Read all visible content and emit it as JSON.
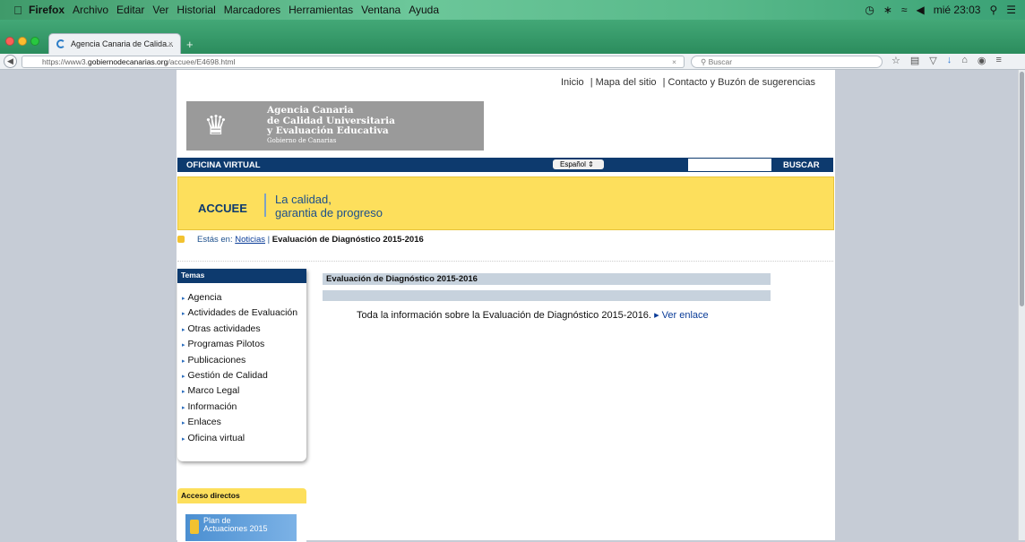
{
  "os_menu": {
    "app": "Firefox",
    "items": [
      "Archivo",
      "Editar",
      "Ver",
      "Historial",
      "Marcadores",
      "Herramientas",
      "Ventana",
      "Ayuda"
    ],
    "clock": "mié 23:03"
  },
  "browser": {
    "tab_title": "Agencia Canaria de Calida...",
    "tab_close": "×",
    "new_tab": "+",
    "url_prefix": "https://www3.",
    "url_domain": "gobiernodecanarias.org",
    "url_path": "/accuee/E4698.html",
    "url_clear": "×",
    "search_placeholder": "Buscar"
  },
  "site": {
    "top_links": [
      "Inicio",
      "| Mapa del sitio",
      "| Contacto y Buzón de sugerencias"
    ],
    "logo_lines": [
      "Agencia Canaria",
      "de Calidad Universitaria",
      "y Evaluación Educativa"
    ],
    "logo_sub": "Gobierno de Canarias",
    "virtual_office": "OFICINA VIRTUAL",
    "language": "Español",
    "search_button": "BUSCAR",
    "banner_acronym": "ACCUEE",
    "banner_slogan_1": "La calidad,",
    "banner_slogan_2": "garantia de progreso",
    "breadcrumb_prefix": "Estás en:",
    "breadcrumb_link": "Noticias",
    "breadcrumb_current": "Evaluación de Diagnóstico 2015-2016",
    "sidebar_title": "Temas",
    "sidebar_items": [
      "Agencia",
      "Actividades de Evaluación",
      "Otras actividades",
      "Programas Pilotos",
      "Publicaciones",
      "Gestión de Calidad",
      "Marco Legal",
      "Información",
      "Enlaces",
      "Oficina virtual"
    ],
    "shortcuts_title": "Acceso directos",
    "plan_button_1": "Plan de",
    "plan_button_2": "Actuaciones 2015",
    "article_title": "Evaluación de Diagnóstico 2015-2016",
    "article_text": "Toda la información sobre la Evaluación de Diagnóstico 2015-2016.",
    "article_link": "Ver enlace"
  }
}
